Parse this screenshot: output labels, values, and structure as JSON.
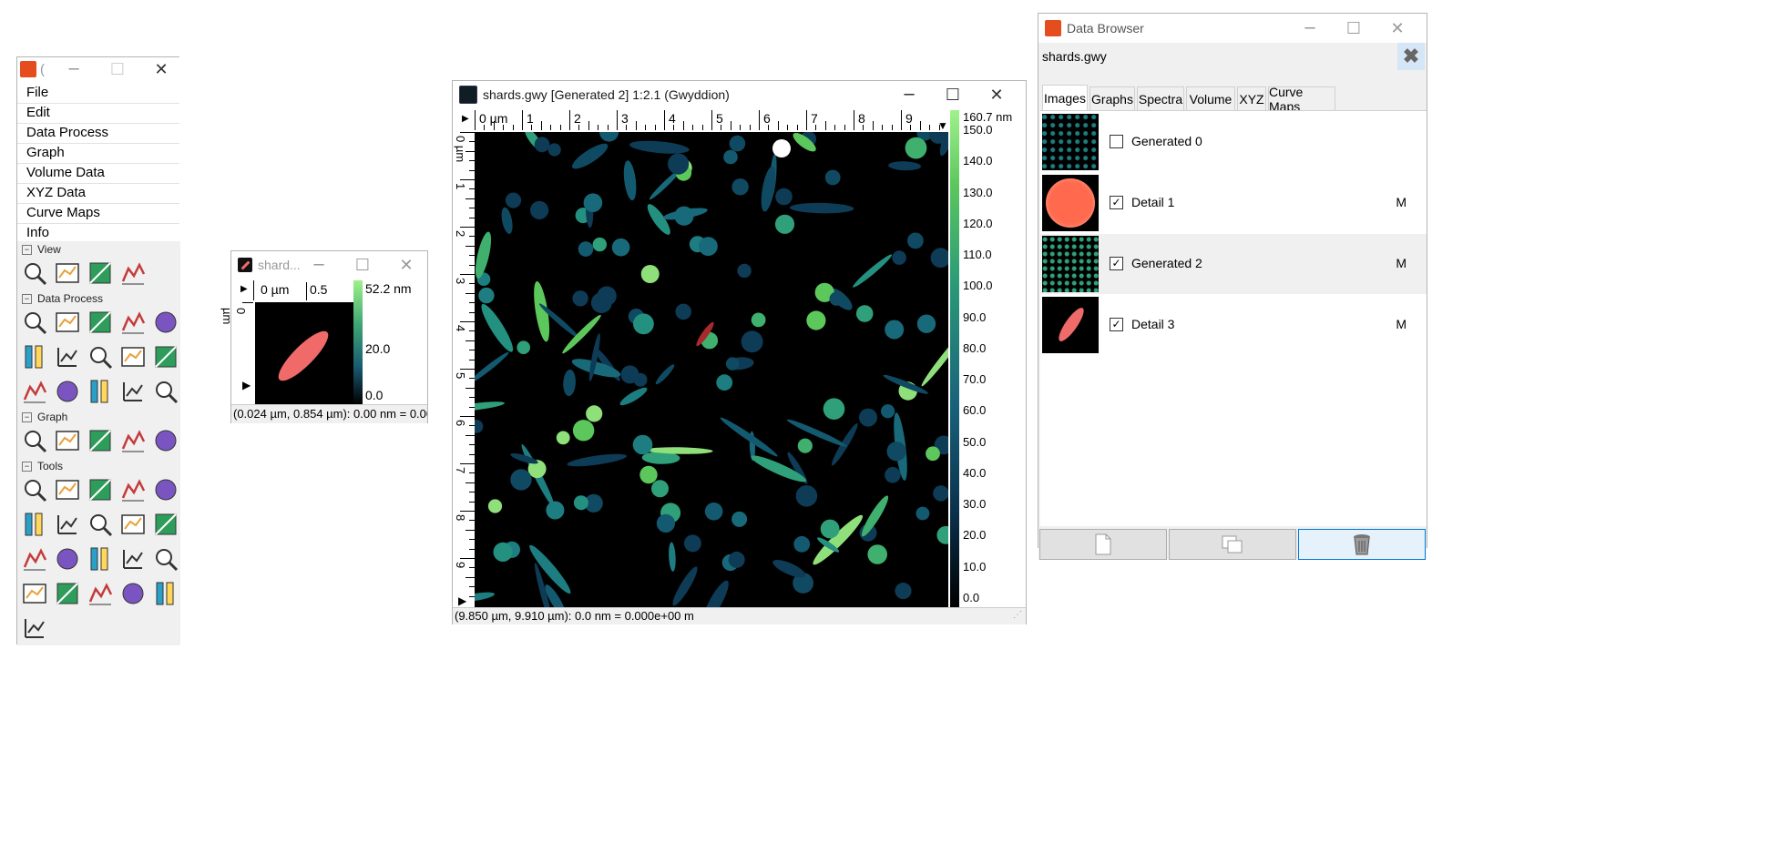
{
  "toolbox": {
    "title": "(",
    "menu": [
      "File",
      "Edit",
      "Data Process",
      "Graph",
      "Volume Data",
      "XYZ Data",
      "Curve Maps",
      "Info"
    ],
    "sections": {
      "view": "View",
      "data_process": "Data Process",
      "graph": "Graph",
      "tools": "Tools"
    },
    "view_tools": [
      "zoom-in-icon",
      "zoom-1-1-icon",
      "zoom-out-icon",
      "3d-view-icon"
    ],
    "data_process_tools": [
      "level-icon",
      "crop-icon",
      "scale-icon",
      "duplicate-icon",
      "gradient-icon",
      "facet-icon",
      "stripes-icon",
      "align-rows-icon",
      "grains-icon",
      "watershed-icon",
      "mask-icon",
      "histogram-icon",
      "sphere-icon",
      "shade-icon",
      "remove-mask-icon"
    ],
    "graph_tools": [
      "graph-fit-icon",
      "graph-curve-icon",
      "graph-overlay-icon",
      "graph-filter-icon",
      "graph-export-icon"
    ],
    "tools": [
      "pointer-icon",
      "distance-icon",
      "crosshair-icon",
      "profile-icon",
      "spectro-icon",
      "stats-icon",
      "level-points-icon",
      "curve-icon",
      "extend-icon",
      "roughness-icon",
      "filter-icon",
      "triangle-icon",
      "path-level-icon",
      "crop-tool-icon",
      "eraser-icon",
      "spot-remove-icon",
      "mask-editor-icon",
      "mask-remove-icon",
      "height-icon",
      "export-icon",
      "line-profile-icon"
    ]
  },
  "small_window": {
    "title": "shard...",
    "x_ruler": [
      "0 µm",
      "0.5"
    ],
    "y_ruler": [
      "0 µm"
    ],
    "scale_labels": [
      "52.2 nm",
      "20.0",
      "0.0"
    ],
    "status": "(0.024 µm, 0.854 µm): 0.00 nm = 0.000"
  },
  "main_window": {
    "title": "shards.gwy [Generated 2] 1:2.1 (Gwyddion)",
    "x_ruler": [
      "0 µm",
      "1",
      "2",
      "3",
      "4",
      "5",
      "6",
      "7",
      "8",
      "9"
    ],
    "y_ruler": [
      "0 µm",
      "1",
      "2",
      "3",
      "4",
      "5",
      "6",
      "7",
      "8",
      "9"
    ],
    "scale_labels": [
      "160.7 nm",
      "150.0",
      "140.0",
      "130.0",
      "120.0",
      "110.0",
      "100.0",
      "90.0",
      "80.0",
      "70.0",
      "60.0",
      "50.0",
      "40.0",
      "30.0",
      "20.0",
      "10.0",
      "0.0"
    ],
    "status": "(9.850 µm, 9.910 µm): 0.0 nm = 0.000e+00 m"
  },
  "data_browser": {
    "title": "Data Browser",
    "file": "shards.gwy",
    "tabs": [
      "Images",
      "Graphs",
      "Spectra",
      "Volume",
      "XYZ",
      "Curve Maps"
    ],
    "active_tab": "Images",
    "rows": [
      {
        "label": "Generated 0",
        "checked": false,
        "mark": ""
      },
      {
        "label": "Detail 1",
        "checked": true,
        "mark": "M"
      },
      {
        "label": "Generated 2",
        "checked": true,
        "mark": "M"
      },
      {
        "label": "Detail 3",
        "checked": true,
        "mark": "M"
      }
    ],
    "buttons": [
      "new-icon",
      "duplicate-icon",
      "delete-icon"
    ]
  },
  "colors": {
    "accent": "#cce8ff",
    "gradient_top": "#9ff28a",
    "gradient_mid": "#1d8a7a",
    "gradient_bottom": "#000000",
    "grain_red": "#f06a6a"
  }
}
